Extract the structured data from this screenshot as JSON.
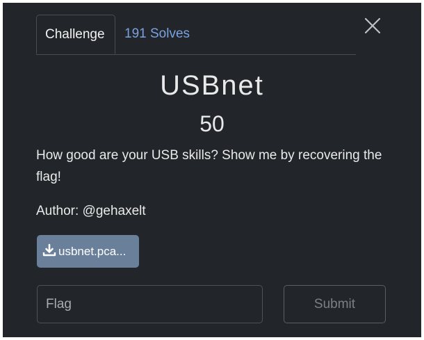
{
  "tabs": {
    "challenge_label": "Challenge",
    "solves_label": "191 Solves"
  },
  "challenge": {
    "name": "USBnet",
    "value": "50",
    "description": "How good are your USB skills? Show me by recovering the flag!",
    "author": "Author: @gehaxelt",
    "file_label": "usbnet.pca..."
  },
  "form": {
    "flag_placeholder": "Flag",
    "submit_label": "Submit"
  },
  "icons": {
    "close": "close-icon",
    "download": "download-icon"
  },
  "colors": {
    "background": "#222529",
    "link": "#7aa2e0",
    "file_button": "#6a7f9a"
  }
}
